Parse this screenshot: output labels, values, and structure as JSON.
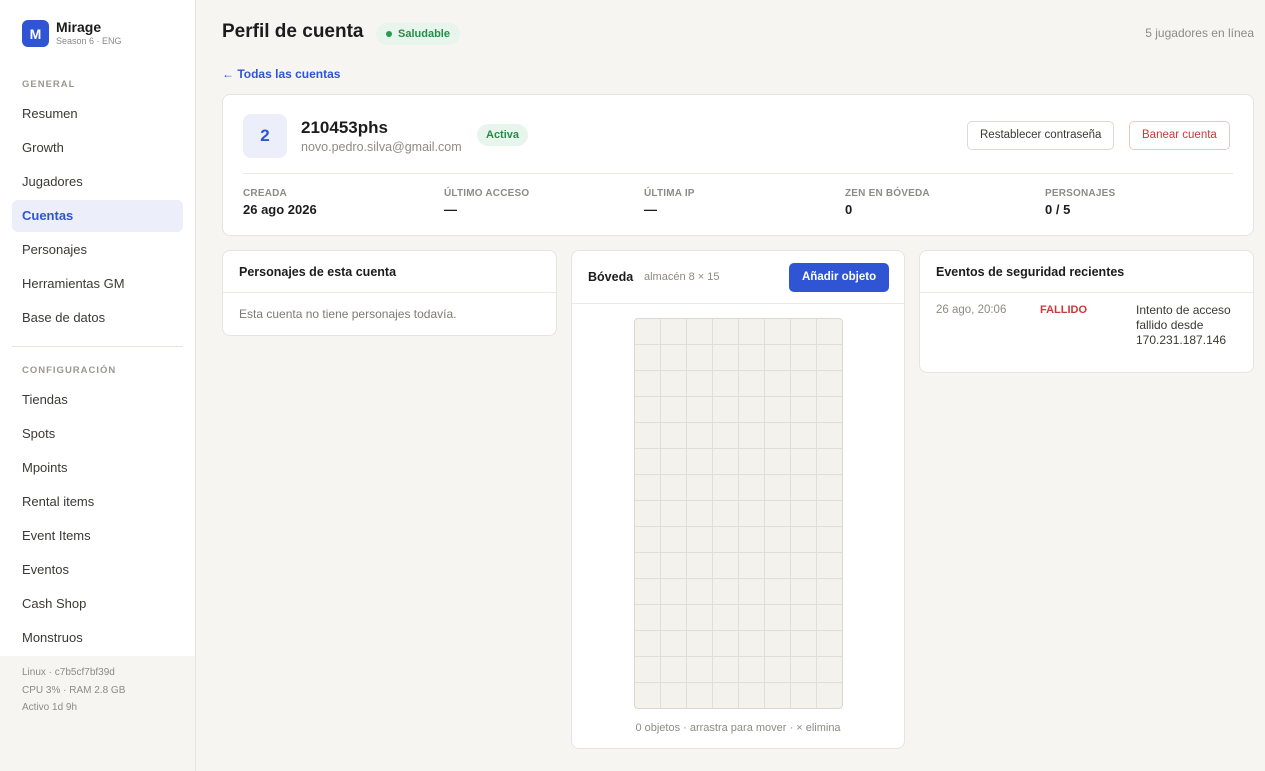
{
  "brand": {
    "logo_letter": "M",
    "name": "Mirage",
    "subtitle": "Season 6 · ENG"
  },
  "sidebar": {
    "section_general": "GENERAL",
    "general_items": [
      "Resumen",
      "Growth",
      "Jugadores",
      "Cuentas",
      "Personajes",
      "Herramientas GM",
      "Base de datos"
    ],
    "active_item": "Cuentas",
    "section_config": "CONFIGURACIÓN",
    "config_items": [
      "Tiendas",
      "Spots",
      "Mpoints",
      "Rental items",
      "Event Items",
      "Eventos",
      "Cash Shop",
      "Monstruos"
    ]
  },
  "system": {
    "host": "Linux · c7b5cf7bf39d",
    "resources": "CPU 3% · RAM 2.8 GB",
    "uptime": "Activo 1d 9h"
  },
  "header": {
    "title": "Perfil de cuenta",
    "health": "Saludable",
    "online": "5 jugadores en línea"
  },
  "back_link": "← Todas las cuentas",
  "account": {
    "avatar": "2",
    "username": "210453phs",
    "email": "novo.pedro.silva@gmail.com",
    "status": "Activa",
    "reset_button": "Restablecer contraseña",
    "ban_button": "Banear cuenta",
    "stats": [
      {
        "label": "CREADA",
        "value": "26 ago 2026"
      },
      {
        "label": "ÚLTIMO ACCESO",
        "value": "—"
      },
      {
        "label": "ÚLTIMA IP",
        "value": "—"
      },
      {
        "label": "ZEN EN BÓVEDA",
        "value": "0"
      },
      {
        "label": "PERSONAJES",
        "value": "0 / 5"
      }
    ]
  },
  "characters": {
    "title": "Personajes de esta cuenta",
    "empty": "Esta cuenta no tiene personajes todavía."
  },
  "vault": {
    "title": "Bóveda",
    "subtitle": "almacén 8 × 15",
    "add_button": "Añadir objeto",
    "columns": 8,
    "rows": 15,
    "footer": "0 objetos · arrastra para mover · × elimina"
  },
  "security": {
    "title": "Eventos de seguridad recientes",
    "events": [
      {
        "time": "26 ago, 20:06",
        "status": "FALLIDO",
        "description": "Intento de acceso fallido desde 170.231.187.146"
      }
    ]
  },
  "colors": {
    "accent": "#2f55d4",
    "success": "#2a8a4a",
    "danger": "#c93a3a"
  }
}
